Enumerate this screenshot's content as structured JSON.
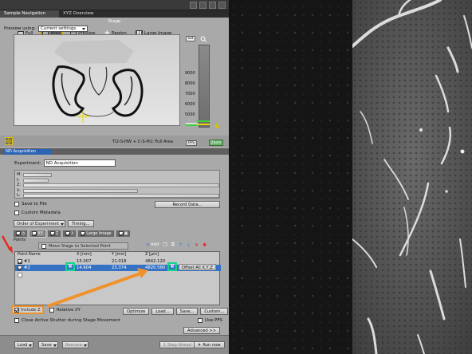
{
  "tabs": [
    "Sample Navigation",
    "XYZ Overview"
  ],
  "stage": {
    "title": "Stage",
    "buttons": [
      "Full",
      "Area",
      "Preview",
      "Region",
      "Large Image"
    ],
    "selected": "Area",
    "preview_label": "Preview using:",
    "preview_value": "Current settings",
    "set_label": "Set",
    "z_ticks": [
      "9000",
      "8000",
      "7000",
      "6000",
      "5000",
      "4000"
    ],
    "status": "TI2-S-HW + C-S-HU: Full Area",
    "pfs_label": "PFS",
    "piezo_label": "Zoom"
  },
  "nd": {
    "header": "ND Acquisition",
    "experiment_label": "Experiment:",
    "experiment_value": "ND Acquisition",
    "dims": [
      "M:",
      "t:",
      "Z:",
      "λ:",
      "L:"
    ],
    "save_to_file": "Save to File",
    "custom_metadata": "Custom Metadata",
    "record_data": "Record Data...",
    "order_label": "Order of Experiment",
    "timing": "Timing...",
    "dim_tabs": [
      "XY",
      "Z",
      "Large Image"
    ],
    "points_label": "Points",
    "move_stage": "Move Stage to Selected Point",
    "add_label": "Add"
  },
  "points": {
    "headers": [
      "Point Name",
      "X [mm]",
      "Y [mm]",
      "Z [µm]"
    ],
    "rows": [
      {
        "name": "#1",
        "x": "15.007",
        "y": "21.018",
        "z": "4842.120",
        "checked": true
      },
      {
        "name": "#2",
        "x": "14.604",
        "y": "23.374",
        "z": "4820.580",
        "checked": true
      }
    ],
    "offset_label": "Offset All X,Y,Z"
  },
  "options": {
    "include_z": "Include Z",
    "relative_xy": "Relative XY",
    "optimize": "Optimize",
    "load": "Load...",
    "save": "Save...",
    "custom": "Custom...",
    "close_shutter": "Close Active Shutter during Stage Movement",
    "use_pfs": "Use PFS",
    "advanced": "Advanced >>"
  },
  "footer": {
    "load": "Load",
    "save": "Save",
    "remove": "Remove",
    "one_step": "1 Step Ahead",
    "run_now": "Run now"
  },
  "colors": {
    "highlight_green": "#12d68c",
    "annotation_orange": "#f0922c",
    "annotation_red": "#e8281d",
    "selection_blue": "#3572c4"
  }
}
